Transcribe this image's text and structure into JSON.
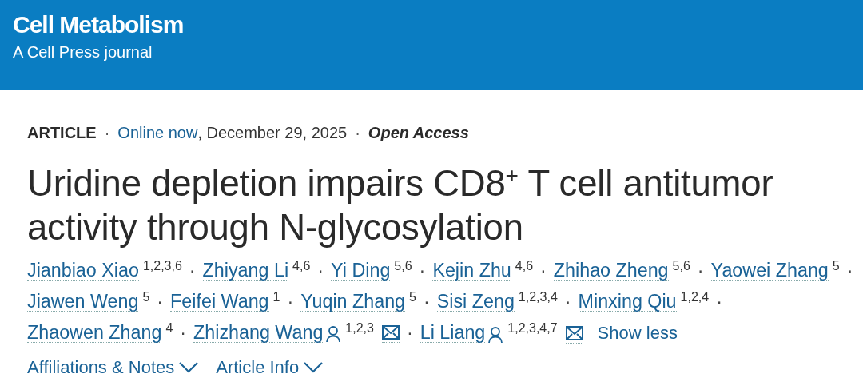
{
  "header": {
    "journal": "Cell Metabolism",
    "tagline": "A Cell Press journal"
  },
  "meta": {
    "type": "ARTICLE",
    "separator_1": "·",
    "status_link": "Online now",
    "date": ", December 29, 2025",
    "separator_2": "·",
    "access": "Open Access"
  },
  "title": "Uridine depletion impairs CD8$^{+}$ T cell antitumor activity through N-glycosylation",
  "authors": [
    {
      "name": "Jianbiao Xiao",
      "affiliations": "1,2,3,6",
      "corresponding": false,
      "separator": "·"
    },
    {
      "name": "Zhiyang Li",
      "affiliations": "4,6",
      "corresponding": false,
      "separator": "·"
    },
    {
      "name": "Yi Ding",
      "affiliations": "5,6",
      "corresponding": false,
      "separator": "·"
    },
    {
      "name": "Kejin Zhu",
      "affiliations": "4,6",
      "corresponding": false,
      "separator": "·"
    },
    {
      "name": "Zhihao Zheng",
      "affiliations": "5,6",
      "corresponding": false,
      "separator": "·"
    },
    {
      "name": "Yaowei Zhang",
      "affiliations": "5",
      "corresponding": false,
      "separator": "·"
    },
    {
      "name": "Jiawen Weng",
      "affiliations": "5",
      "corresponding": false,
      "separator": "·"
    },
    {
      "name": "Feifei Wang",
      "affiliations": "1",
      "corresponding": false,
      "separator": "·"
    },
    {
      "name": "Yuqin Zhang",
      "affiliations": "5",
      "corresponding": false,
      "separator": "·"
    },
    {
      "name": "Sisi Zeng",
      "affiliations": "1,2,3,4",
      "corresponding": false,
      "separator": "·"
    },
    {
      "name": "Minxing Qiu",
      "affiliations": "1,2,4",
      "corresponding": false,
      "separator": "·"
    },
    {
      "name": "Zhaowen Zhang",
      "affiliations": "4",
      "corresponding": false,
      "separator": "·"
    },
    {
      "name": "Zhizhang Wang",
      "affiliations": "1,2,3",
      "corresponding": true,
      "separator": "·"
    },
    {
      "name": "Li Liang",
      "affiliations": "1,2,3,4,7",
      "corresponding": true
    }
  ],
  "show_less": "Show less",
  "sections": [
    {
      "label": "Affiliations & Notes",
      "expanded": false
    },
    {
      "label": "Article Info",
      "expanded": false
    }
  ]
}
